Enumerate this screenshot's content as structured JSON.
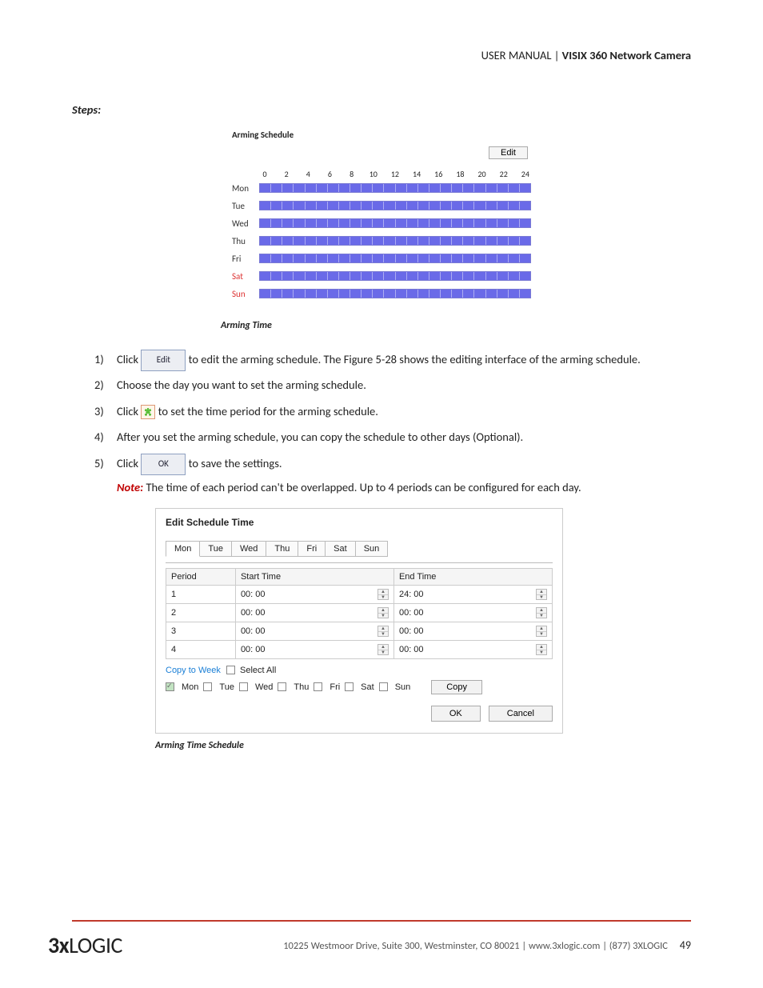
{
  "header": {
    "left": "USER MANUAL | ",
    "bold": "VISIX 360 Network Camera"
  },
  "steps_heading": "Steps:",
  "arming": {
    "title": "Arming Schedule",
    "edit_btn": "Edit",
    "hours": [
      "0",
      "2",
      "4",
      "6",
      "8",
      "10",
      "12",
      "14",
      "16",
      "18",
      "20",
      "22",
      "24"
    ],
    "days": [
      "Mon",
      "Tue",
      "Wed",
      "Thu",
      "Fri",
      "Sat",
      "Sun"
    ],
    "caption": "Arming Time"
  },
  "list": {
    "s1a": "Click ",
    "s1_btn": "Edit",
    "s1b": " to edit the arming schedule. The Figure 5-28 shows the editing interface of the arming schedule.",
    "s2": "Choose the day you want to set the arming schedule.",
    "s3a": "Click ",
    "s3b": " to set the time period for the arming schedule.",
    "s4": "After you set the arming schedule, you can copy the schedule to other days (Optional).",
    "s5a": "Click ",
    "s5_btn": "OK",
    "s5b": " to save the settings.",
    "note_label": "Note:",
    "note_text": " The time of each period can't be overlapped. Up to 4 periods can be configured for each day."
  },
  "edit": {
    "title": "Edit Schedule Time",
    "tabs": [
      "Mon",
      "Tue",
      "Wed",
      "Thu",
      "Fri",
      "Sat",
      "Sun"
    ],
    "cols": {
      "period": "Period",
      "start": "Start Time",
      "end": "End Time"
    },
    "rows": [
      {
        "n": "1",
        "start": "00: 00",
        "end": "24: 00"
      },
      {
        "n": "2",
        "start": "00: 00",
        "end": "00: 00"
      },
      {
        "n": "3",
        "start": "00: 00",
        "end": "00: 00"
      },
      {
        "n": "4",
        "start": "00: 00",
        "end": "00: 00"
      }
    ],
    "copy_label": "Copy to Week",
    "select_all": "Select All",
    "daychks": [
      "Mon",
      "Tue",
      "Wed",
      "Thu",
      "Fri",
      "Sat",
      "Sun"
    ],
    "copy_btn": "Copy",
    "ok": "OK",
    "cancel": "Cancel",
    "caption": "Arming Time Schedule"
  },
  "footer": {
    "brand_3": "3",
    "brand_x": "x",
    "brand_rest": "LOGIC",
    "addr": "10225 Westmoor Drive, Suite 300, Westminster, CO 80021 | www.3xlogic.com | (877) 3XLOGIC",
    "page": "49"
  }
}
